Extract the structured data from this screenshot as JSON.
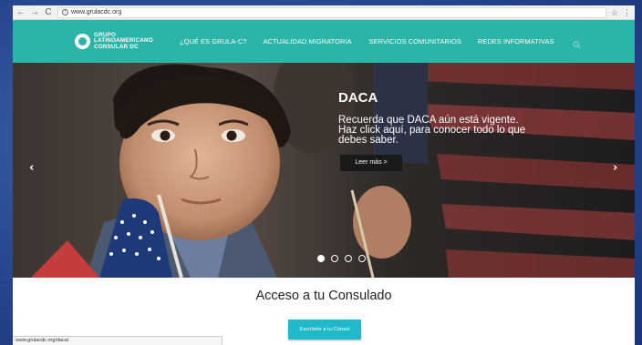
{
  "browser": {
    "url": "www.grulacdc.org",
    "status_url": "www.grulacdc.org/daca/"
  },
  "site": {
    "logo_text": "GRUPO\nLATINOAMERICANO\nCONSULAR DC",
    "nav": [
      {
        "label": "¿QUÉ ES GRULA-C?"
      },
      {
        "label": "ACTUALIDAD MIGRATORIA"
      },
      {
        "label": "SERVICIOS COMUNITARIOS"
      },
      {
        "label": "REDES INFORMATIVAS"
      }
    ]
  },
  "hero": {
    "title": "DACA",
    "text": "Recuerda que DACA aún está vigente. Haz click aquí, para conocer todo lo que debes saber.",
    "button": "Leer más >",
    "prev_symbol": "‹",
    "next_symbol": "›",
    "slide_count": 4,
    "active_slide": 1
  },
  "main": {
    "section_title": "Acceso a tu Consulado",
    "cta_label": "Escríbele a tu Cónsul"
  },
  "colors": {
    "header_teal": "#2bb5a7",
    "cta_cyan": "#1fb9c9"
  }
}
